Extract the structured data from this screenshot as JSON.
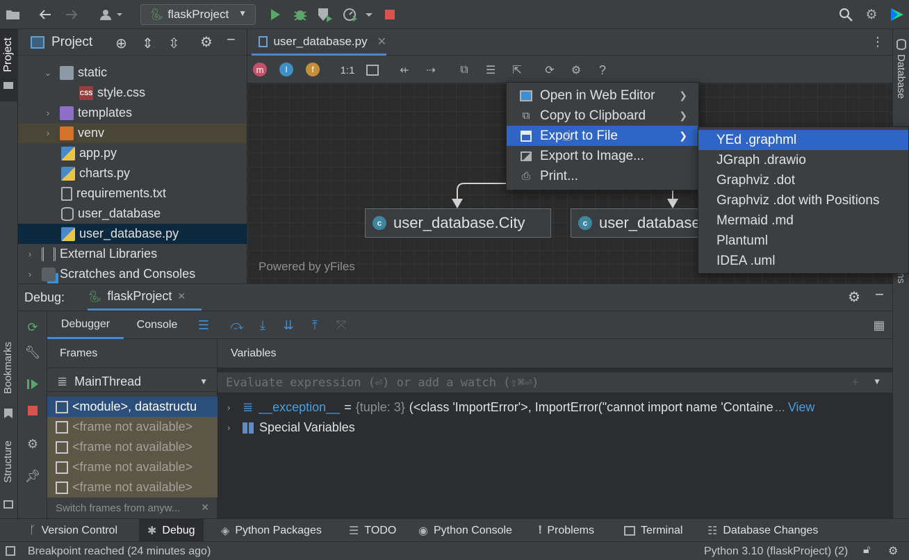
{
  "toolbar": {
    "run_config": "flaskProject"
  },
  "left_strip": {
    "project_label": "Project",
    "bookmarks_label": "Bookmarks",
    "structure_label": "Structure"
  },
  "right_strip": {
    "database_label": "Database",
    "partial_label": "ns"
  },
  "project_panel": {
    "title": "Project",
    "tree": [
      {
        "label": "static",
        "kind": "folder"
      },
      {
        "label": "style.css",
        "kind": "css"
      },
      {
        "label": "templates",
        "kind": "folder-purple"
      },
      {
        "label": "venv",
        "kind": "folder-orange"
      },
      {
        "label": "app.py",
        "kind": "python"
      },
      {
        "label": "charts.py",
        "kind": "python"
      },
      {
        "label": "requirements.txt",
        "kind": "text"
      },
      {
        "label": "user_database",
        "kind": "db"
      },
      {
        "label": "user_database.py",
        "kind": "python"
      },
      {
        "label": "External Libraries",
        "kind": "library"
      },
      {
        "label": "Scratches and Consoles",
        "kind": "scratch"
      }
    ],
    "badge_css": "CSS"
  },
  "editor": {
    "tab_label": "user_database.py",
    "diagram_badges": {
      "m": "m",
      "i": "I",
      "f": "f"
    },
    "zoom_label": "1:1",
    "help_label": "?",
    "watermark": "Powered by yFiles",
    "nodes": [
      {
        "label": "user_database.City",
        "badge": "c"
      },
      {
        "label": "user_database",
        "badge": "c"
      }
    ]
  },
  "context_menu": {
    "items": [
      {
        "label": "Open in Web Editor",
        "submenu": true
      },
      {
        "label": "Copy to Clipboard",
        "submenu": true
      },
      {
        "label": "Export to File",
        "submenu": true
      },
      {
        "label": "Export to Image...",
        "submenu": false
      },
      {
        "label": "Print...",
        "submenu": false
      }
    ]
  },
  "export_submenu": {
    "items": [
      "YEd .graphml",
      "JGraph .drawio",
      "Graphviz .dot",
      "Graphviz .dot with Positions",
      "Mermaid .md",
      "Plantuml",
      "IDEA .uml"
    ]
  },
  "debug": {
    "label": "Debug:",
    "session": "flaskProject",
    "tabs": [
      "Debugger",
      "Console"
    ],
    "frames_header": "Frames",
    "variables_header": "Variables",
    "thread": "MainThread",
    "frames": [
      "<module>, datastructu",
      "<frame not available>",
      "<frame not available>",
      "<frame not available>",
      "<frame not available>"
    ],
    "switch_hint": "Switch frames from anyw...",
    "eval_placeholder": "Evaluate expression (⏎) or add a watch (⇧⌘⏎)",
    "variables": {
      "exception_name": "__exception__",
      "exception_eq": "=",
      "exception_type": "{tuple: 3}",
      "exception_value": "(<class 'ImportError'>, ImportError(\"cannot import name 'Containe",
      "ellipsis": "...",
      "view": "View",
      "special": "Special Variables"
    }
  },
  "bottom_tools": [
    "Version Control",
    "Debug",
    "Python Packages",
    "TODO",
    "Python Console",
    "Problems",
    "Terminal",
    "Database Changes"
  ],
  "status": {
    "message": "Breakpoint reached (24 minutes ago)",
    "interpreter": "Python 3.10 (flaskProject) (2)"
  },
  "colors": {
    "accent": "#2e65c6",
    "run_green": "#59a869",
    "stop_red": "#d9534f"
  }
}
